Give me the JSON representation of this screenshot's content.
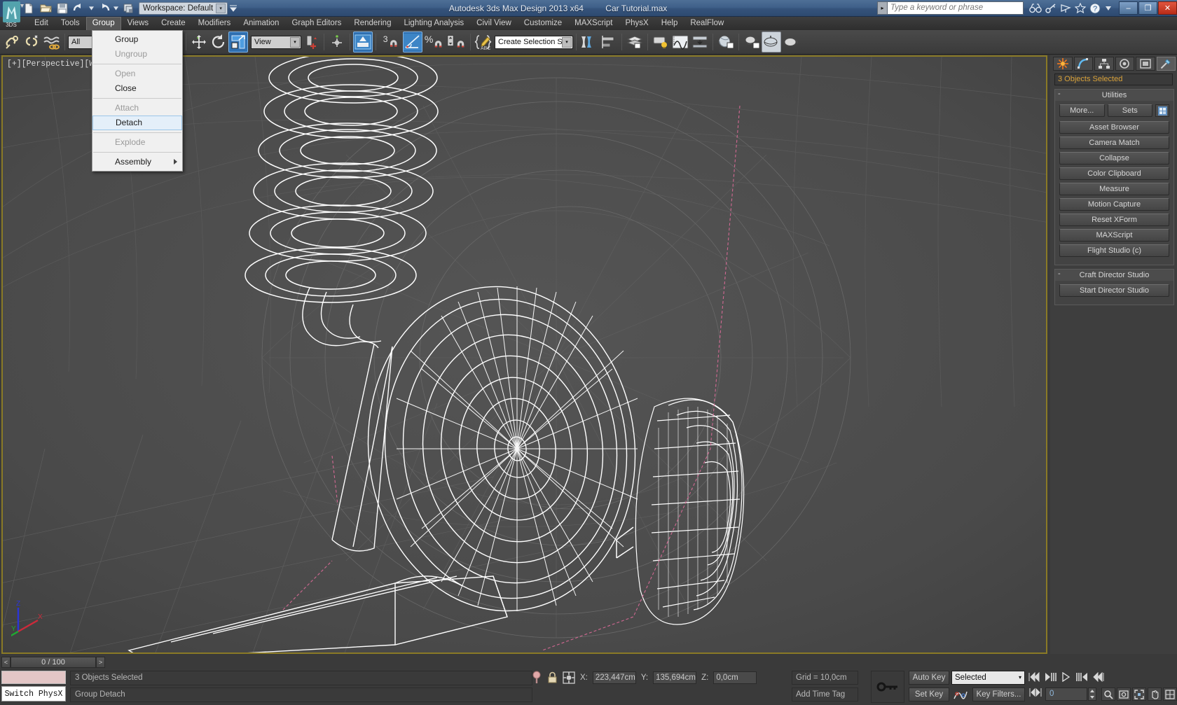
{
  "titlebar": {
    "app_title": "Autodesk 3ds Max Design 2013 x64",
    "file_name": "Car Tutorial.max",
    "workspace_label": "Workspace: Default",
    "search_placeholder": "Type a keyword or phrase",
    "minimize": "–",
    "maximize": "❐",
    "close": "✕"
  },
  "menubar": {
    "items": [
      {
        "label": "Edit",
        "active": false
      },
      {
        "label": "Tools",
        "active": false
      },
      {
        "label": "Group",
        "active": true
      },
      {
        "label": "Views",
        "active": false
      },
      {
        "label": "Create",
        "active": false
      },
      {
        "label": "Modifiers",
        "active": false
      },
      {
        "label": "Animation",
        "active": false
      },
      {
        "label": "Graph Editors",
        "active": false
      },
      {
        "label": "Rendering",
        "active": false
      },
      {
        "label": "Lighting Analysis",
        "active": false
      },
      {
        "label": "Civil View",
        "active": false
      },
      {
        "label": "Customize",
        "active": false
      },
      {
        "label": "MAXScript",
        "active": false
      },
      {
        "label": "PhysX",
        "active": false
      },
      {
        "label": "Help",
        "active": false
      },
      {
        "label": "RealFlow",
        "active": false
      }
    ]
  },
  "group_menu": {
    "items": [
      {
        "label": "Group",
        "state": "enabled",
        "submenu": false
      },
      {
        "label": "Ungroup",
        "state": "disabled",
        "submenu": false
      },
      {
        "sep": true
      },
      {
        "label": "Open",
        "state": "disabled",
        "submenu": false
      },
      {
        "label": "Close",
        "state": "enabled",
        "submenu": false
      },
      {
        "sep": true
      },
      {
        "label": "Attach",
        "state": "disabled",
        "submenu": false
      },
      {
        "label": "Detach",
        "state": "highlighted",
        "submenu": false
      },
      {
        "sep": true
      },
      {
        "label": "Explode",
        "state": "disabled",
        "submenu": false
      },
      {
        "sep": true
      },
      {
        "label": "Assembly",
        "state": "enabled",
        "submenu": true
      }
    ]
  },
  "toolbar": {
    "selection_filter": "All",
    "named_selection_sets": "Create Selection Se",
    "reference_coord_system": "View",
    "snap_value": "3",
    "percent_symbol": "%",
    "icons": [
      "select-link-icon",
      "unlink-icon",
      "bind-space-warp-icon",
      "select-object-icon",
      "select-by-name-icon",
      "select-region-icon",
      "window-crossing-icon",
      "select-and-move-icon",
      "select-and-rotate-icon",
      "select-and-scale-icon",
      "mirror-icon",
      "align-icon",
      "snaps-toggle-icon",
      "angle-snap-icon",
      "percent-snap-icon",
      "spinner-snap-icon",
      "edit-named-selection-icon",
      "mirror-pivot-icon",
      "array-icon",
      "layer-manager-icon",
      "graphite-modeling-icon",
      "curve-editor-icon",
      "schematic-view-icon",
      "material-editor-icon",
      "render-setup-icon",
      "rendered-frame-icon",
      "render-production-icon"
    ]
  },
  "viewport": {
    "label": "[+][Perspective][Wirefra",
    "axis": {
      "x": "X",
      "y": "Y",
      "z": "Z"
    }
  },
  "command_panel": {
    "tabs": [
      {
        "name": "create-tab",
        "selected": false
      },
      {
        "name": "modify-tab",
        "selected": false
      },
      {
        "name": "hierarchy-tab",
        "selected": false
      },
      {
        "name": "motion-tab",
        "selected": false
      },
      {
        "name": "display-tab",
        "selected": false
      },
      {
        "name": "utilities-tab",
        "selected": true
      }
    ],
    "object_name": "3 Objects Selected",
    "rollouts": [
      {
        "title": "Utilities",
        "collapse": "-",
        "top_buttons": [
          "More...",
          "Sets"
        ],
        "buttons": [
          "Asset Browser",
          "Camera Match",
          "Collapse",
          "Color Clipboard",
          "Measure",
          "Motion Capture",
          "Reset XForm",
          "MAXScript",
          "Flight Studio (c)"
        ]
      },
      {
        "title": "Craft Director Studio",
        "collapse": "-",
        "top_buttons": [],
        "buttons": [
          "Start Director Studio"
        ]
      }
    ]
  },
  "time_slider": {
    "prev": "<",
    "next": ">",
    "current": "0 / 100"
  },
  "status_bar": {
    "physx_switch": "Switch PhysX",
    "selection_status": "3 Objects Selected",
    "prompt_line": "Group Detach",
    "coords": {
      "x_label": "X:",
      "x_value": "223,447cm",
      "y_label": "Y:",
      "y_value": "135,694cm",
      "z_label": "Z:",
      "z_value": "0,0cm"
    },
    "grid": "Grid = 10,0cm",
    "add_time_tag": "Add Time Tag",
    "auto_key": "Auto Key",
    "set_key": "Set Key",
    "key_mode": "Selected",
    "key_filters": "Key Filters...",
    "frame_value": "0"
  },
  "colors": {
    "viewport_border": "#8a7a26",
    "accent_blue": "#2f6fb0",
    "panel_bg": "#3e3e3e",
    "toolbar_bg": "#3a3a3a",
    "title_blue": "#3f6089",
    "orange_text": "#d9a23a"
  }
}
